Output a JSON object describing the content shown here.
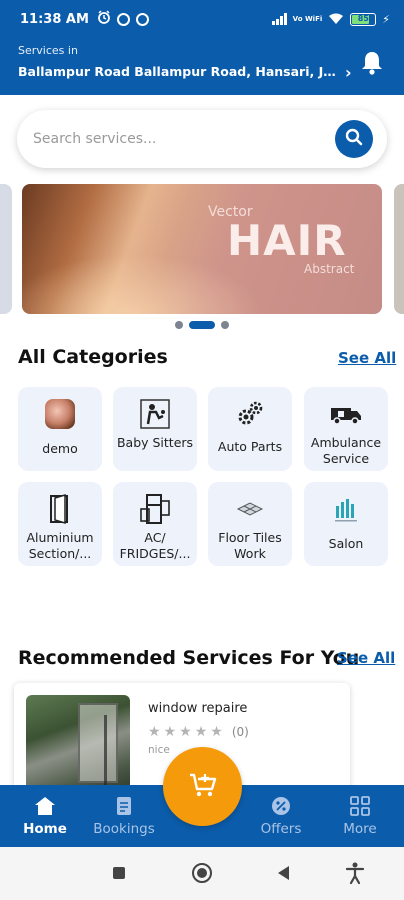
{
  "status_bar": {
    "time": "11:38 AM",
    "network": "Vo WiFi",
    "battery": "85"
  },
  "header": {
    "services_label": "Services in",
    "address": "Ballampur Road Ballampur Road, Hansari, Jhansi, Uttar Pradesh"
  },
  "search": {
    "placeholder": "Search services..."
  },
  "banner": {
    "line1": "Vector",
    "line2": "HAIR",
    "line3": "Abstract",
    "slide_count": 3,
    "active_slide": 2
  },
  "categories_section": {
    "title": "All Categories",
    "see_all": "See All",
    "items": [
      {
        "label": "demo",
        "icon": "demo-photo-icon"
      },
      {
        "label": "Baby Sitters",
        "icon": "baby-sitter-icon"
      },
      {
        "label": "Auto Parts",
        "icon": "gears-icon"
      },
      {
        "label": "Ambulance Service",
        "icon": "ambulance-icon"
      },
      {
        "label": "Aluminium Section/...",
        "icon": "door-icon"
      },
      {
        "label": "AC/ FRIDGES/...",
        "icon": "fridge-icon"
      },
      {
        "label": "Floor Tiles Work",
        "icon": "tiles-icon"
      },
      {
        "label": "Salon",
        "icon": "salon-icon"
      }
    ]
  },
  "recommended_section": {
    "title": "Recommended Services For You",
    "see_all": "See All",
    "cards": [
      {
        "title": "window repaire",
        "rating_count": "(0)",
        "description": "nice",
        "rating": 0,
        "max_rating": 5
      }
    ]
  },
  "bottom_nav": {
    "items": [
      {
        "label": "Home",
        "icon": "home-icon",
        "active": true
      },
      {
        "label": "Bookings",
        "icon": "bookings-icon",
        "active": false
      },
      {
        "label": "Offers",
        "icon": "offers-icon",
        "active": false
      },
      {
        "label": "More",
        "icon": "grid-icon",
        "active": false
      }
    ],
    "fab_icon": "cart-add-icon"
  },
  "colors": {
    "primary": "#0b5cab",
    "accent": "#f59a0b",
    "category_bg": "#eef3fb"
  }
}
